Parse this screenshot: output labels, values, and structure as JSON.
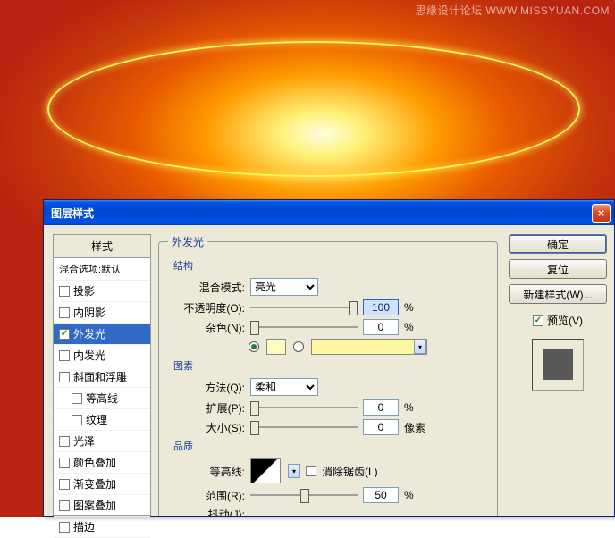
{
  "watermark": "思缘设计论坛  WWW.MISSYUAN.COM",
  "dialog": {
    "title": "图层样式",
    "styles_header": "样式",
    "blend_default": "混合选项:默认",
    "items": [
      {
        "label": "投影",
        "active": false,
        "checked": false
      },
      {
        "label": "内阴影",
        "active": false,
        "checked": false
      },
      {
        "label": "外发光",
        "active": true,
        "checked": true
      },
      {
        "label": "内发光",
        "active": false,
        "checked": false
      },
      {
        "label": "斜面和浮雕",
        "active": false,
        "checked": false
      },
      {
        "label": "等高线",
        "active": false,
        "checked": false,
        "indent": true
      },
      {
        "label": "纹理",
        "active": false,
        "checked": false,
        "indent": true
      },
      {
        "label": "光泽",
        "active": false,
        "checked": false
      },
      {
        "label": "颜色叠加",
        "active": false,
        "checked": false
      },
      {
        "label": "渐变叠加",
        "active": false,
        "checked": false
      },
      {
        "label": "图案叠加",
        "active": false,
        "checked": false
      },
      {
        "label": "描边",
        "active": false,
        "checked": false
      }
    ]
  },
  "panel": {
    "group_outer": "外发光",
    "sec_struct": "结构",
    "blend_mode_label": "混合模式:",
    "blend_mode_value": "亮光",
    "opacity_label": "不透明度(O):",
    "opacity_value": "100",
    "pct": "%",
    "noise_label": "杂色(N):",
    "noise_value": "0",
    "sec_elem": "图素",
    "method_label": "方法(Q):",
    "method_value": "柔和",
    "spread_label": "扩展(P):",
    "spread_value": "0",
    "size_label": "大小(S):",
    "size_value": "0",
    "px": "像素",
    "sec_quality": "品质",
    "contour_label": "等高线:",
    "antialias": "消除锯齿(L)",
    "range_label": "范围(R):",
    "range_value": "50",
    "jitter_label": "抖动(J):"
  },
  "buttons": {
    "ok": "确定",
    "reset": "复位",
    "newstyle": "新建样式(W)...",
    "preview": "预览(V)"
  }
}
